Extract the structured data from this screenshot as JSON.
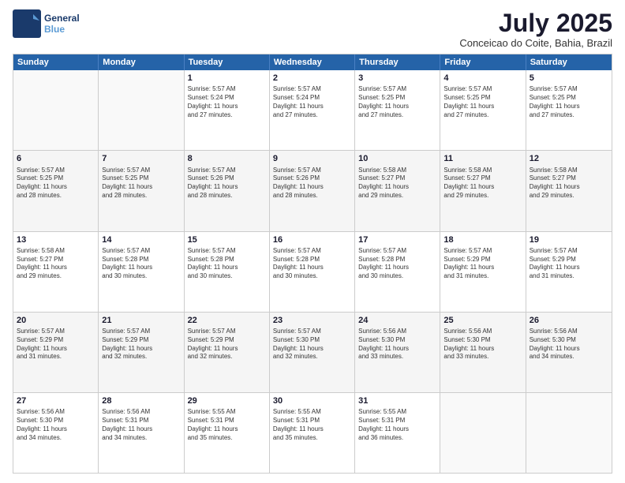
{
  "logo": {
    "line1": "General",
    "line2": "Blue"
  },
  "title": {
    "month_year": "July 2025",
    "location": "Conceicao do Coite, Bahia, Brazil"
  },
  "days_of_week": [
    "Sunday",
    "Monday",
    "Tuesday",
    "Wednesday",
    "Thursday",
    "Friday",
    "Saturday"
  ],
  "weeks": [
    [
      {
        "day": "",
        "content": ""
      },
      {
        "day": "",
        "content": ""
      },
      {
        "day": "1",
        "content": "Sunrise: 5:57 AM\nSunset: 5:24 PM\nDaylight: 11 hours\nand 27 minutes."
      },
      {
        "day": "2",
        "content": "Sunrise: 5:57 AM\nSunset: 5:24 PM\nDaylight: 11 hours\nand 27 minutes."
      },
      {
        "day": "3",
        "content": "Sunrise: 5:57 AM\nSunset: 5:25 PM\nDaylight: 11 hours\nand 27 minutes."
      },
      {
        "day": "4",
        "content": "Sunrise: 5:57 AM\nSunset: 5:25 PM\nDaylight: 11 hours\nand 27 minutes."
      },
      {
        "day": "5",
        "content": "Sunrise: 5:57 AM\nSunset: 5:25 PM\nDaylight: 11 hours\nand 27 minutes."
      }
    ],
    [
      {
        "day": "6",
        "content": "Sunrise: 5:57 AM\nSunset: 5:25 PM\nDaylight: 11 hours\nand 28 minutes."
      },
      {
        "day": "7",
        "content": "Sunrise: 5:57 AM\nSunset: 5:25 PM\nDaylight: 11 hours\nand 28 minutes."
      },
      {
        "day": "8",
        "content": "Sunrise: 5:57 AM\nSunset: 5:26 PM\nDaylight: 11 hours\nand 28 minutes."
      },
      {
        "day": "9",
        "content": "Sunrise: 5:57 AM\nSunset: 5:26 PM\nDaylight: 11 hours\nand 28 minutes."
      },
      {
        "day": "10",
        "content": "Sunrise: 5:58 AM\nSunset: 5:27 PM\nDaylight: 11 hours\nand 29 minutes."
      },
      {
        "day": "11",
        "content": "Sunrise: 5:58 AM\nSunset: 5:27 PM\nDaylight: 11 hours\nand 29 minutes."
      },
      {
        "day": "12",
        "content": "Sunrise: 5:58 AM\nSunset: 5:27 PM\nDaylight: 11 hours\nand 29 minutes."
      }
    ],
    [
      {
        "day": "13",
        "content": "Sunrise: 5:58 AM\nSunset: 5:27 PM\nDaylight: 11 hours\nand 29 minutes."
      },
      {
        "day": "14",
        "content": "Sunrise: 5:57 AM\nSunset: 5:28 PM\nDaylight: 11 hours\nand 30 minutes."
      },
      {
        "day": "15",
        "content": "Sunrise: 5:57 AM\nSunset: 5:28 PM\nDaylight: 11 hours\nand 30 minutes."
      },
      {
        "day": "16",
        "content": "Sunrise: 5:57 AM\nSunset: 5:28 PM\nDaylight: 11 hours\nand 30 minutes."
      },
      {
        "day": "17",
        "content": "Sunrise: 5:57 AM\nSunset: 5:28 PM\nDaylight: 11 hours\nand 30 minutes."
      },
      {
        "day": "18",
        "content": "Sunrise: 5:57 AM\nSunset: 5:29 PM\nDaylight: 11 hours\nand 31 minutes."
      },
      {
        "day": "19",
        "content": "Sunrise: 5:57 AM\nSunset: 5:29 PM\nDaylight: 11 hours\nand 31 minutes."
      }
    ],
    [
      {
        "day": "20",
        "content": "Sunrise: 5:57 AM\nSunset: 5:29 PM\nDaylight: 11 hours\nand 31 minutes."
      },
      {
        "day": "21",
        "content": "Sunrise: 5:57 AM\nSunset: 5:29 PM\nDaylight: 11 hours\nand 32 minutes."
      },
      {
        "day": "22",
        "content": "Sunrise: 5:57 AM\nSunset: 5:29 PM\nDaylight: 11 hours\nand 32 minutes."
      },
      {
        "day": "23",
        "content": "Sunrise: 5:57 AM\nSunset: 5:30 PM\nDaylight: 11 hours\nand 32 minutes."
      },
      {
        "day": "24",
        "content": "Sunrise: 5:56 AM\nSunset: 5:30 PM\nDaylight: 11 hours\nand 33 minutes."
      },
      {
        "day": "25",
        "content": "Sunrise: 5:56 AM\nSunset: 5:30 PM\nDaylight: 11 hours\nand 33 minutes."
      },
      {
        "day": "26",
        "content": "Sunrise: 5:56 AM\nSunset: 5:30 PM\nDaylight: 11 hours\nand 34 minutes."
      }
    ],
    [
      {
        "day": "27",
        "content": "Sunrise: 5:56 AM\nSunset: 5:30 PM\nDaylight: 11 hours\nand 34 minutes."
      },
      {
        "day": "28",
        "content": "Sunrise: 5:56 AM\nSunset: 5:31 PM\nDaylight: 11 hours\nand 34 minutes."
      },
      {
        "day": "29",
        "content": "Sunrise: 5:55 AM\nSunset: 5:31 PM\nDaylight: 11 hours\nand 35 minutes."
      },
      {
        "day": "30",
        "content": "Sunrise: 5:55 AM\nSunset: 5:31 PM\nDaylight: 11 hours\nand 35 minutes."
      },
      {
        "day": "31",
        "content": "Sunrise: 5:55 AM\nSunset: 5:31 PM\nDaylight: 11 hours\nand 36 minutes."
      },
      {
        "day": "",
        "content": ""
      },
      {
        "day": "",
        "content": ""
      }
    ]
  ]
}
